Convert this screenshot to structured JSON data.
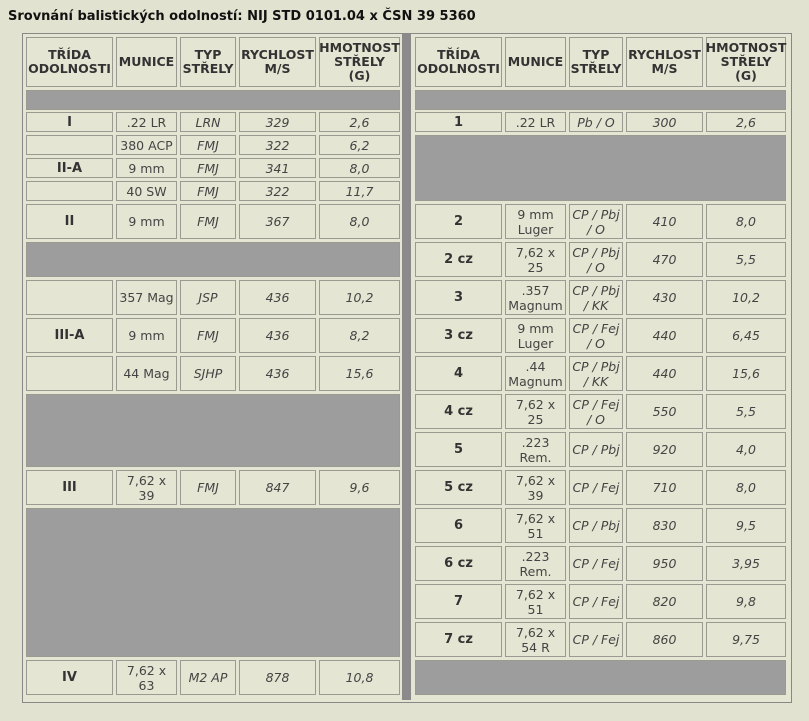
{
  "title": "Srovnání balistických odolností: NIJ STD 0101.04 x ČSN 39 5360",
  "headers": {
    "class": "TŘÍDA\nODOLNOSTI",
    "ammo": "MUNICE",
    "type": "TYP\nSTŘELY",
    "speed": "RYCHLOST\nM/S",
    "mass": "HMOTNOST\nSTŘELY\n(G)"
  },
  "nij": {
    "rows": [
      {
        "ammo": ".22 LR",
        "type": "LRN",
        "speed": "329",
        "mass": "2,6"
      },
      {
        "ammo": "380 ACP",
        "type": "FMJ",
        "speed": "322",
        "mass": "6,2"
      },
      {
        "ammo": "9 mm",
        "type": "FMJ",
        "speed": "341",
        "mass": "8,0"
      },
      {
        "ammo": "40 SW",
        "type": "FMJ",
        "speed": "322",
        "mass": "11,7"
      },
      {
        "ammo": "9 mm",
        "type": "FMJ",
        "speed": "367",
        "mass": "8,0"
      },
      {
        "ammo": "357 Mag",
        "type": "JSP",
        "speed": "436",
        "mass": "10,2"
      },
      {
        "ammo": "9 mm",
        "type": "FMJ",
        "speed": "436",
        "mass": "8,2"
      },
      {
        "ammo": "44 Mag",
        "type": "SJHP",
        "speed": "436",
        "mass": "15,6"
      },
      {
        "ammo": "7,62 x\n39",
        "type": "FMJ",
        "speed": "847",
        "mass": "9,6"
      },
      {
        "ammo": "7,62 x\n63",
        "type": "M2 AP",
        "speed": "878",
        "mass": "10,8"
      }
    ],
    "classes": [
      "I",
      "II-A",
      "II",
      "III-A",
      "III",
      "IV"
    ]
  },
  "csn": {
    "rows": [
      {
        "cls": "1",
        "ammo": ".22 LR",
        "type": "Pb / O",
        "speed": "300",
        "mass": "2,6"
      },
      {
        "cls": "2",
        "ammo": "9 mm\nLuger",
        "type": "CP / Pbj\n/ O",
        "speed": "410",
        "mass": "8,0"
      },
      {
        "cls": "2 cz",
        "ammo": "7,62 x\n25",
        "type": "CP / Pbj\n/ O",
        "speed": "470",
        "mass": "5,5"
      },
      {
        "cls": "3",
        "ammo": ".357\nMagnum",
        "type": "CP / Pbj\n/ KK",
        "speed": "430",
        "mass": "10,2"
      },
      {
        "cls": "3 cz",
        "ammo": "9 mm\nLuger",
        "type": "CP / Fej\n/ O",
        "speed": "440",
        "mass": "6,45"
      },
      {
        "cls": "4",
        "ammo": ".44\nMagnum",
        "type": "CP / Pbj\n/ KK",
        "speed": "440",
        "mass": "15,6"
      },
      {
        "cls": "4 cz",
        "ammo": "7,62 x\n25",
        "type": "CP / Fej\n/ O",
        "speed": "550",
        "mass": "5,5"
      },
      {
        "cls": "5",
        "ammo": ".223\nRem.",
        "type": "CP / Pbj",
        "speed": "920",
        "mass": "4,0"
      },
      {
        "cls": "5 cz",
        "ammo": "7,62 x\n39",
        "type": "CP / Fej",
        "speed": "710",
        "mass": "8,0"
      },
      {
        "cls": "6",
        "ammo": "7,62 x\n51",
        "type": "CP / Pbj",
        "speed": "830",
        "mass": "9,5"
      },
      {
        "cls": "6 cz",
        "ammo": ".223\nRem.",
        "type": "CP / Fej",
        "speed": "950",
        "mass": "3,95"
      },
      {
        "cls": "7",
        "ammo": "7,62 x\n51",
        "type": "CP / Fej",
        "speed": "820",
        "mass": "9,8"
      },
      {
        "cls": "7 cz",
        "ammo": "7,62 x\n54 R",
        "type": "CP / Fej",
        "speed": "860",
        "mass": "9,75"
      }
    ]
  }
}
